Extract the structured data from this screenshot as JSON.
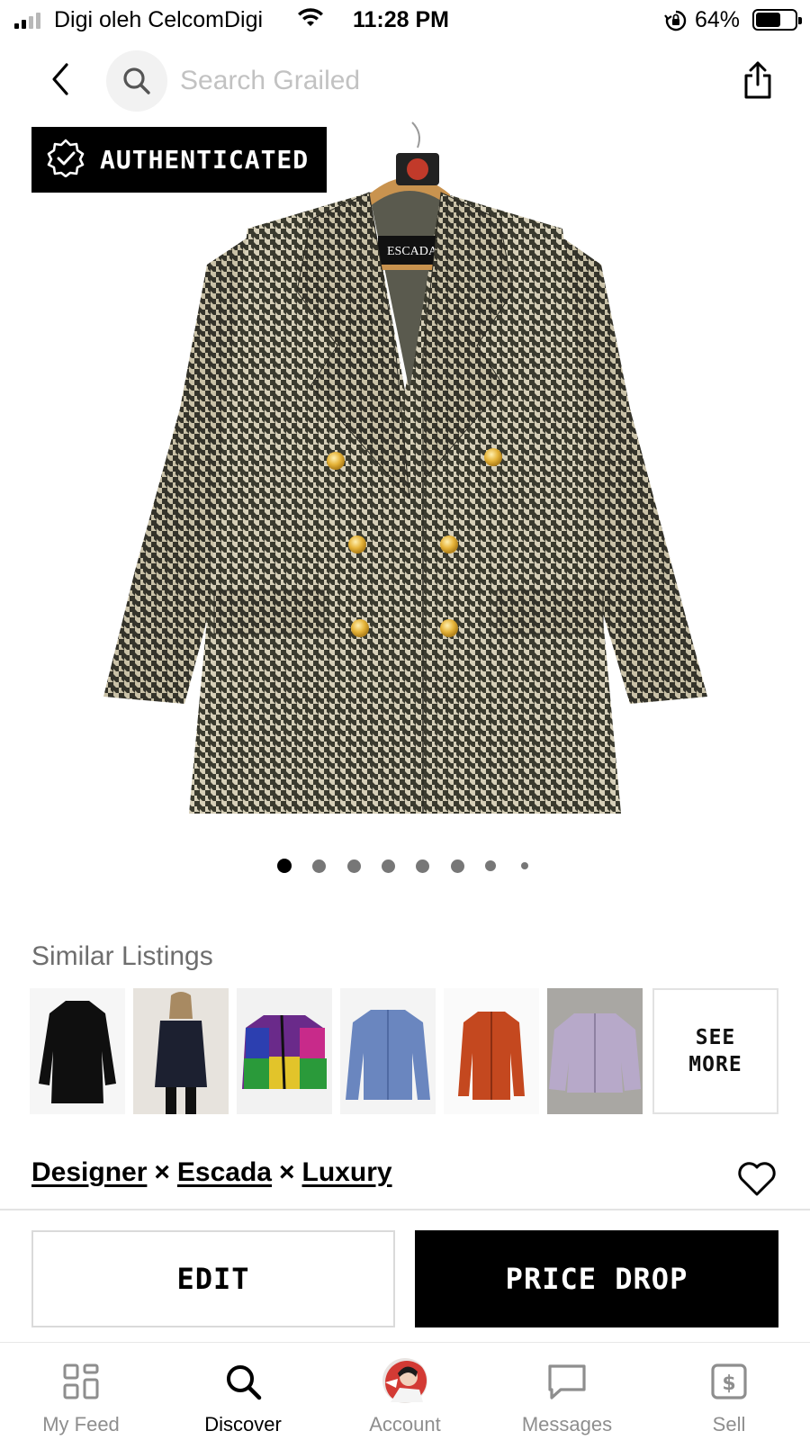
{
  "status_bar": {
    "carrier": "Digi oleh CelcomDigi",
    "time": "11:28 PM",
    "battery_percent": "64%",
    "battery_level": 0.64,
    "icons": [
      "signal-icon",
      "wifi-icon",
      "orientation-lock-icon",
      "battery-icon"
    ]
  },
  "top_nav": {
    "search_placeholder": "Search Grailed",
    "icons": [
      "back-arrow-icon",
      "search-icon",
      "share-icon"
    ]
  },
  "product": {
    "badge_label": "AUTHENTICATED",
    "badge_icon": "verified-check-icon",
    "image_count": 8,
    "active_image_index": 0
  },
  "similar": {
    "title": "Similar Listings",
    "items": [
      {
        "kind": "black-coat"
      },
      {
        "kind": "navy-peacoat-model"
      },
      {
        "kind": "colorblock-jacket"
      },
      {
        "kind": "blue-suede-jacket"
      },
      {
        "kind": "orange-jacket"
      },
      {
        "kind": "lavender-bomber"
      }
    ],
    "see_more_line1": "SEE",
    "see_more_line2": "MORE"
  },
  "tags": {
    "items": [
      "Designer",
      "Escada",
      "Luxury"
    ],
    "separator": "×"
  },
  "actions": {
    "edit_label": "EDIT",
    "price_drop_label": "PRICE DROP"
  },
  "tab_bar": {
    "tabs": [
      {
        "label": "My Feed",
        "icon": "grid-feed-icon",
        "active": false
      },
      {
        "label": "Discover",
        "icon": "search-icon",
        "active": true
      },
      {
        "label": "Account",
        "icon": "avatar",
        "active": false
      },
      {
        "label": "Messages",
        "icon": "message-bubble-icon",
        "active": false
      },
      {
        "label": "Sell",
        "icon": "dollar-tag-icon",
        "active": false
      }
    ]
  },
  "colors": {
    "accent": "#000000",
    "muted_text": "#8e8e8e",
    "placeholder": "#c2c2c2",
    "houndstooth_dark": "#3b3a2f",
    "houndstooth_light": "#d9d2bd",
    "button_gold": "#e6b43a"
  }
}
